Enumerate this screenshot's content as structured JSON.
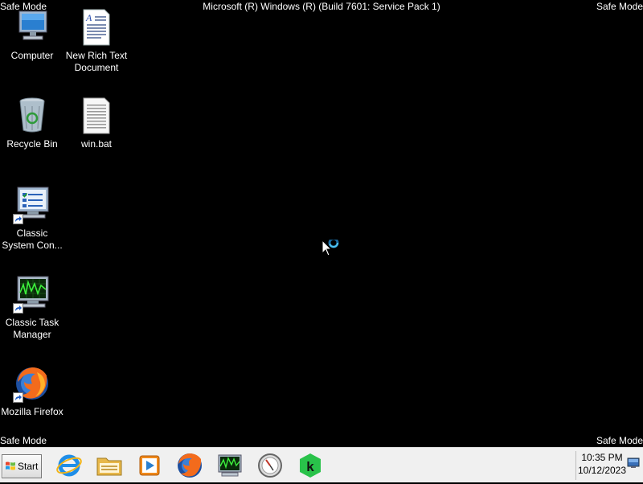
{
  "overlay": {
    "safe_mode": "Safe Mode",
    "build": "Microsoft (R) Windows (R) (Build 7601: Service Pack 1)"
  },
  "desktop": {
    "icons": [
      {
        "label": "Computer",
        "icon": "computer-icon"
      },
      {
        "label": "New Rich Text Document",
        "icon": "rich-text-document-icon"
      },
      {
        "label": "Recycle Bin",
        "icon": "recycle-bin-icon"
      },
      {
        "label": "win.bat",
        "icon": "batch-file-icon"
      },
      {
        "label": "Classic System Con...",
        "icon": "system-config-icon"
      },
      {
        "label": "Classic Task Manager",
        "icon": "task-manager-icon"
      },
      {
        "label": "Mozilla Firefox",
        "icon": "firefox-icon"
      }
    ]
  },
  "taskbar": {
    "start_label": "Start",
    "apps": [
      {
        "name": "Internet Explorer",
        "icon": "internet-explorer-icon"
      },
      {
        "name": "Windows Explorer",
        "icon": "folder-icon"
      },
      {
        "name": "Windows Media Player",
        "icon": "media-player-icon"
      },
      {
        "name": "Mozilla Firefox",
        "icon": "firefox-icon"
      },
      {
        "name": "Task Manager",
        "icon": "task-manager-icon"
      },
      {
        "name": "Clock App",
        "icon": "clock-app-icon"
      },
      {
        "name": "Kaspersky",
        "icon": "kaspersky-icon"
      }
    ],
    "clock": {
      "time": "10:35 PM",
      "date": "10/12/2023"
    }
  },
  "colors": {
    "desktop_background": "#000000",
    "taskbar_background": "#f0f0f0",
    "kaspersky_green": "#29c24a",
    "firefox_orange": "#f36b1c"
  }
}
